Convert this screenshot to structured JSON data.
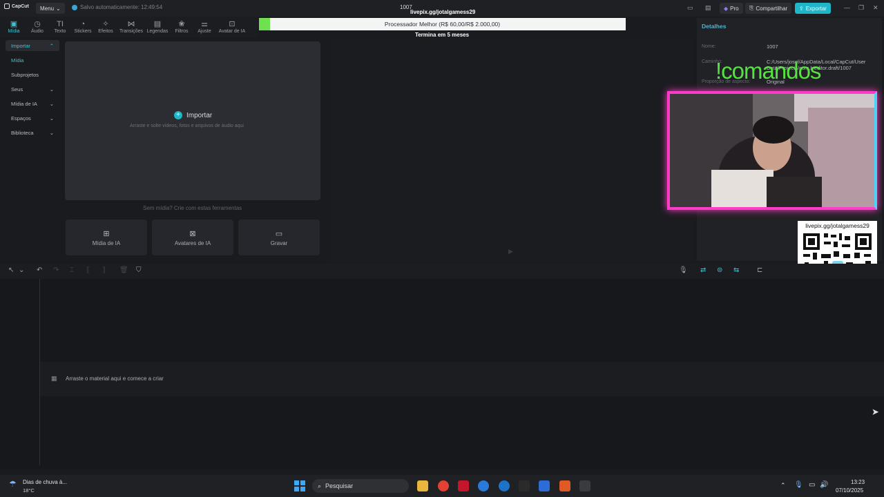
{
  "titlebar": {
    "app_name": "CapCut",
    "menu_label": "Menu",
    "autosave": "Salvo automaticamente: 12:49:54",
    "project_title": "1007",
    "livepix_top": "livepix.gg/jotalgamess29",
    "pro_label": "Pro",
    "share_label": "Compartilhar",
    "export_label": "Exportar"
  },
  "toolbar": {
    "tabs": [
      {
        "label": "Mídia",
        "icon": "media-icon"
      },
      {
        "label": "Áudio",
        "icon": "audio-icon"
      },
      {
        "label": "Texto",
        "icon": "text-icon"
      },
      {
        "label": "Stickers",
        "icon": "sticker-icon"
      },
      {
        "label": "Efeitos",
        "icon": "effects-icon"
      },
      {
        "label": "Transições",
        "icon": "transition-icon"
      },
      {
        "label": "Legendas",
        "icon": "captions-icon"
      },
      {
        "label": "Filtros",
        "icon": "filters-icon"
      },
      {
        "label": "Ajuste",
        "icon": "adjust-icon"
      },
      {
        "label": "Avatar de IA",
        "icon": "avatar-icon"
      }
    ]
  },
  "sidebar": {
    "items": [
      {
        "label": "Importar"
      },
      {
        "label": "Mídia"
      },
      {
        "label": "Subprojetos"
      },
      {
        "label": "Seus"
      },
      {
        "label": "Mídia de IA"
      },
      {
        "label": "Espaços"
      },
      {
        "label": "Biblioteca"
      }
    ]
  },
  "media_panel": {
    "import_label": "Importar",
    "import_hint": "Arraste e solte vídeos, fotos e arquivos de áudio aqui",
    "no_media": "Sem mídia? Crie com estas ferramentas",
    "tools": [
      {
        "label": "Mídia de IA"
      },
      {
        "label": "Avatares de IA"
      },
      {
        "label": "Gravar"
      }
    ]
  },
  "overlay": {
    "processor_text": "Processador Melhor (R$ 60,00/R$ 2.000,00)",
    "processor_progress": 0.03,
    "processor_sub": "Termina em 5 meses",
    "comandos": "!comandos",
    "qr_text": "livepix.gg/jotalgamess29"
  },
  "details": {
    "title": "Detalhes",
    "name_label": "Nome:",
    "name_value": "1007",
    "path_label": "Caminho:",
    "path_value": "C:/Users/josel/AppData/Local/CapCut/User Data/Projects/com.lveditor.draft/1007",
    "aspect_label": "Proporção de aspecto:",
    "aspect_value": "Original"
  },
  "timeline": {
    "drop_text": "Arraste o material aqui e comece a criar"
  },
  "taskbar": {
    "weather_line1": "Dias de chuva à...",
    "weather_line2": "18°C",
    "search_placeholder": "Pesquisar",
    "time": "13:23",
    "date": "07/10/2025"
  }
}
